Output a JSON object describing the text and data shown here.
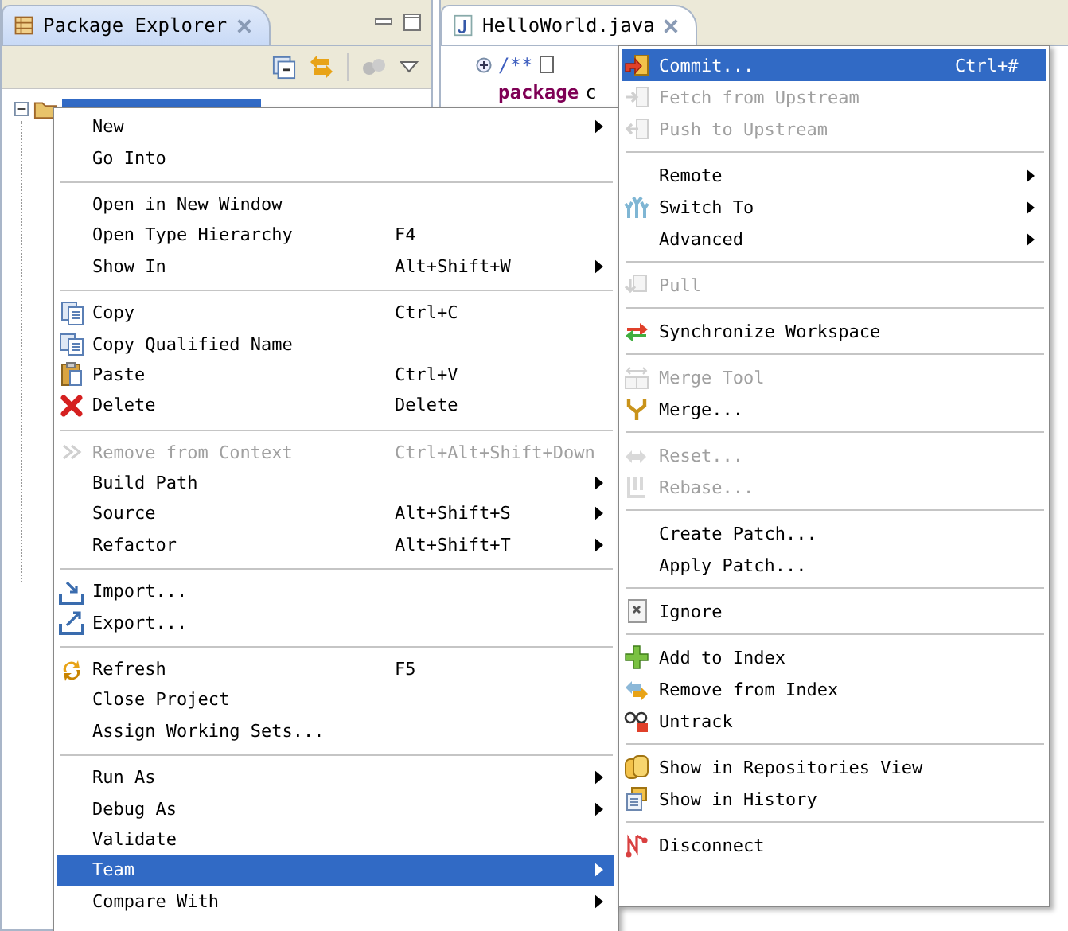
{
  "package_explorer": {
    "tab": {
      "title": "Package Explorer"
    }
  },
  "editor": {
    "tab": {
      "title": "HelloWorld.java"
    },
    "lines": [
      {
        "kind": "folded",
        "text": "/**"
      },
      {
        "kind": "keyword",
        "text": "package",
        "rest": "c"
      }
    ]
  },
  "context_menu": {
    "items": [
      {
        "kind": "item",
        "label": "New",
        "submenu": true,
        "disabled": false,
        "selected": false
      },
      {
        "kind": "item",
        "label": "Go Into",
        "disabled": false,
        "selected": false
      },
      {
        "kind": "separator"
      },
      {
        "kind": "item",
        "label": "Open in New Window",
        "disabled": false,
        "selected": false
      },
      {
        "kind": "item",
        "label": "Open Type Hierarchy",
        "shortcut": "F4",
        "disabled": false,
        "selected": false
      },
      {
        "kind": "item",
        "label": "Show In",
        "shortcut": "Alt+Shift+W",
        "submenu": true,
        "disabled": false,
        "selected": false
      },
      {
        "kind": "separator"
      },
      {
        "kind": "item",
        "label": "Copy",
        "shortcut": "Ctrl+C",
        "disabled": false,
        "selected": false
      },
      {
        "kind": "item",
        "label": "Copy Qualified Name",
        "disabled": false,
        "selected": false
      },
      {
        "kind": "item",
        "label": "Paste",
        "shortcut": "Ctrl+V",
        "disabled": false,
        "selected": false
      },
      {
        "kind": "item",
        "label": "Delete",
        "shortcut": "Delete",
        "disabled": false,
        "selected": false
      },
      {
        "kind": "separator"
      },
      {
        "kind": "item",
        "label": "Remove from Context",
        "shortcut": "Ctrl+Alt+Shift+Down",
        "disabled": true,
        "selected": false
      },
      {
        "kind": "item",
        "label": "Build Path",
        "submenu": true,
        "disabled": false,
        "selected": false
      },
      {
        "kind": "item",
        "label": "Source",
        "shortcut": "Alt+Shift+S",
        "submenu": true,
        "disabled": false,
        "selected": false
      },
      {
        "kind": "item",
        "label": "Refactor",
        "shortcut": "Alt+Shift+T",
        "submenu": true,
        "disabled": false,
        "selected": false
      },
      {
        "kind": "separator"
      },
      {
        "kind": "item",
        "label": "Import...",
        "disabled": false,
        "selected": false
      },
      {
        "kind": "item",
        "label": "Export...",
        "disabled": false,
        "selected": false
      },
      {
        "kind": "separator"
      },
      {
        "kind": "item",
        "label": "Refresh",
        "shortcut": "F5",
        "disabled": false,
        "selected": false
      },
      {
        "kind": "item",
        "label": "Close Project",
        "disabled": false,
        "selected": false
      },
      {
        "kind": "item",
        "label": "Assign Working Sets...",
        "disabled": false,
        "selected": false
      },
      {
        "kind": "separator"
      },
      {
        "kind": "item",
        "label": "Run As",
        "submenu": true,
        "disabled": false,
        "selected": false
      },
      {
        "kind": "item",
        "label": "Debug As",
        "submenu": true,
        "disabled": false,
        "selected": false
      },
      {
        "kind": "item",
        "label": "Validate",
        "disabled": false,
        "selected": false
      },
      {
        "kind": "item",
        "label": "Team",
        "submenu": true,
        "disabled": false,
        "selected": true
      },
      {
        "kind": "item",
        "label": "Compare With",
        "submenu": true,
        "disabled": false,
        "selected": false
      }
    ]
  },
  "team_submenu": {
    "items": [
      {
        "kind": "item",
        "label": "Commit...",
        "shortcut": "Ctrl+#",
        "disabled": false,
        "selected": true
      },
      {
        "kind": "item",
        "label": "Fetch from Upstream",
        "disabled": true,
        "selected": false
      },
      {
        "kind": "item",
        "label": "Push to Upstream",
        "disabled": true,
        "selected": false
      },
      {
        "kind": "separator"
      },
      {
        "kind": "item",
        "label": "Remote",
        "submenu": true,
        "disabled": false,
        "selected": false
      },
      {
        "kind": "item",
        "label": "Switch To",
        "submenu": true,
        "disabled": false,
        "selected": false
      },
      {
        "kind": "item",
        "label": "Advanced",
        "submenu": true,
        "disabled": false,
        "selected": false
      },
      {
        "kind": "separator"
      },
      {
        "kind": "item",
        "label": "Pull",
        "disabled": true,
        "selected": false
      },
      {
        "kind": "separator"
      },
      {
        "kind": "item",
        "label": "Synchronize Workspace",
        "disabled": false,
        "selected": false
      },
      {
        "kind": "separator"
      },
      {
        "kind": "item",
        "label": "Merge Tool",
        "disabled": true,
        "selected": false
      },
      {
        "kind": "item",
        "label": "Merge...",
        "disabled": false,
        "selected": false
      },
      {
        "kind": "separator"
      },
      {
        "kind": "item",
        "label": "Reset...",
        "disabled": true,
        "selected": false
      },
      {
        "kind": "item",
        "label": "Rebase...",
        "disabled": true,
        "selected": false
      },
      {
        "kind": "separator"
      },
      {
        "kind": "item",
        "label": "Create Patch...",
        "disabled": false,
        "selected": false
      },
      {
        "kind": "item",
        "label": "Apply Patch...",
        "disabled": false,
        "selected": false
      },
      {
        "kind": "separator"
      },
      {
        "kind": "item",
        "label": "Ignore",
        "disabled": false,
        "selected": false
      },
      {
        "kind": "separator"
      },
      {
        "kind": "item",
        "label": "Add to Index",
        "disabled": false,
        "selected": false
      },
      {
        "kind": "item",
        "label": "Remove from Index",
        "disabled": false,
        "selected": false
      },
      {
        "kind": "item",
        "label": "Untrack",
        "disabled": false,
        "selected": false
      },
      {
        "kind": "separator"
      },
      {
        "kind": "item",
        "label": "Show in Repositories View",
        "disabled": false,
        "selected": false
      },
      {
        "kind": "item",
        "label": "Show in History",
        "disabled": false,
        "selected": false
      },
      {
        "kind": "separator"
      },
      {
        "kind": "item",
        "label": "Disconnect",
        "disabled": false,
        "selected": false
      }
    ]
  }
}
